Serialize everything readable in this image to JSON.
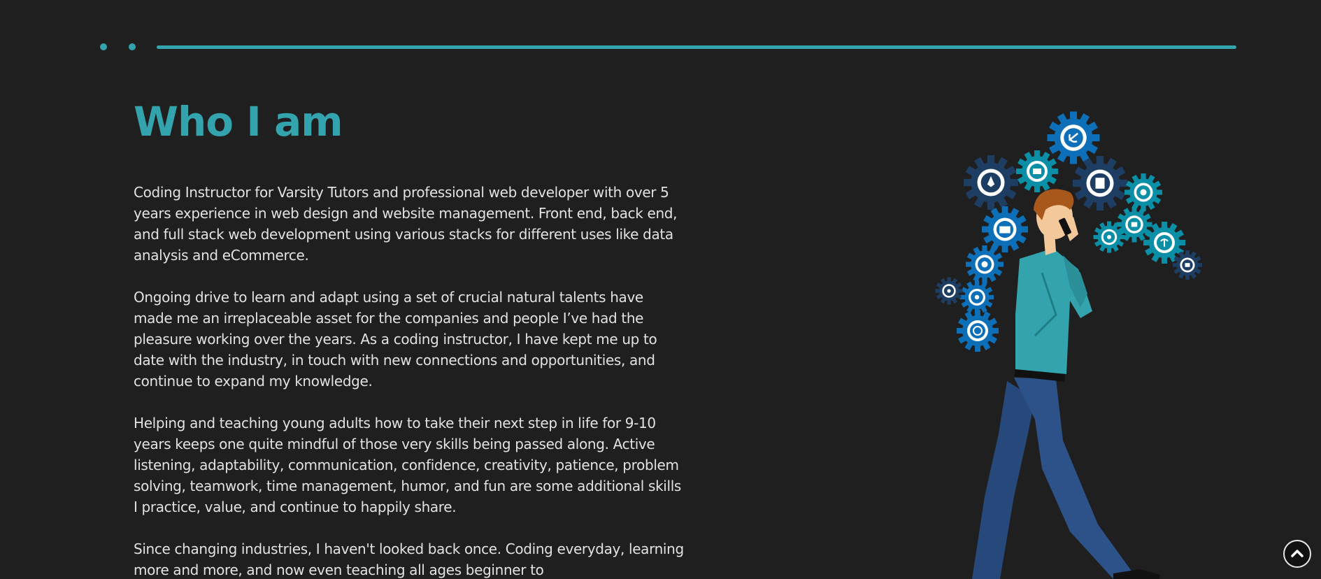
{
  "section": {
    "title": "Who I am",
    "paragraphs": [
      "Coding Instructor for Varsity Tutors and professional web developer with over 5 years experience in web design and website management. Front end, back end, and full stack web development using various stacks for different uses like data analysis and eCommerce.",
      "Ongoing drive to learn and adapt using a set of crucial natural talents have made me an irreplaceable asset for the companies and people I’ve had the pleasure working over the years. As a coding instructor, I have kept me up to date with the industry, in touch with new connections and opportunities, and continue to expand my knowledge.",
      "Helping and teaching young adults how to take their next step in life for 9-10 years keeps one quite mindful of those very skills being passed along. Active listening, adaptability, communication, confidence, creativity, patience, problem solving, teamwork, time management, humor, and fun are some additional skills I practice, value, and continue to happily share.",
      "Since changing industries, I haven't looked back once. Coding everyday, learning more and more, and now even teaching all ages beginner to"
    ]
  },
  "illustration": {
    "icon": "man-walking-phone-gears-illustration"
  },
  "scroll_top": {
    "icon": "chevron-up-icon"
  },
  "colors": {
    "background": "#1f1f1f",
    "accent": "#33a3ad",
    "text": "#e2e2e2",
    "gear_dark": "#1e3d63",
    "gear_blue": "#0d6fb8",
    "gear_teal": "#0a8fa6",
    "shirt": "#33a3ad",
    "pants": "#26487a",
    "hair": "#a8581b"
  }
}
